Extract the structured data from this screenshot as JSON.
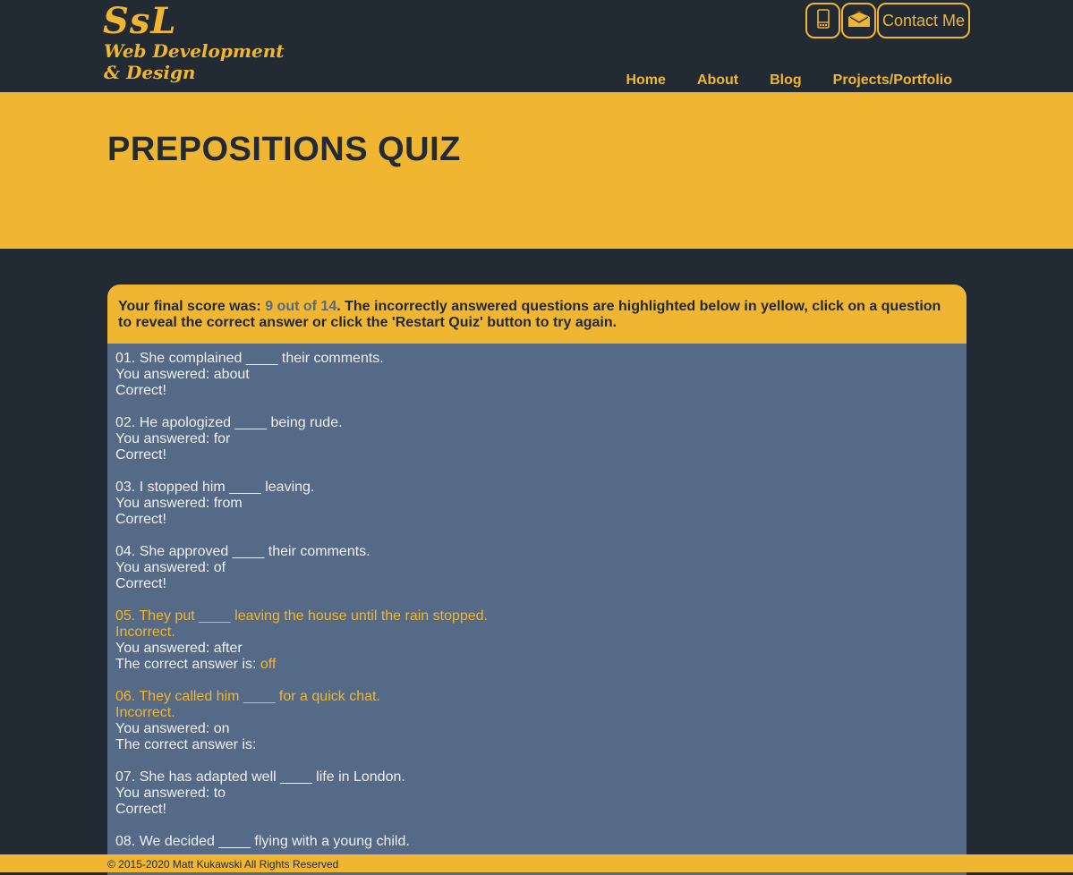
{
  "brand": {
    "mark": "SsL",
    "line1": "Web Development",
    "line2": "& Design"
  },
  "contact": {
    "phone_icon": "mobile-phone-icon",
    "email_icon": "envelope-icon",
    "label": "Contact Me"
  },
  "nav": {
    "items": [
      "Home",
      "About",
      "Blog",
      "Projects/Portfolio"
    ]
  },
  "hero": {
    "title": "PREPOSITIONS QUIZ"
  },
  "score": {
    "prefix": "Your final score was: ",
    "value": "9 out of 14",
    "suffix": ". The incorrectly answered questions are highlighted below in yellow, click on a question to reveal the correct answer or click the 'Restart Quiz' button to try again."
  },
  "questions": [
    {
      "text": "01. She complained ____ their comments.",
      "answered": "You answered: about",
      "status": "Correct!"
    },
    {
      "text": "02. He apologized ____ being rude.",
      "answered": "You answered: for",
      "status": "Correct!"
    },
    {
      "text": "03. I stopped him ____ leaving.",
      "answered": "You answered: from",
      "status": "Correct!"
    },
    {
      "text": "04. She approved ____ their comments.",
      "answered": "You answered: of",
      "status": "Correct!"
    },
    {
      "text": "05. They put ____ leaving the house until the rain stopped.",
      "status": "Incorrect.",
      "answered": "You answered: after",
      "correct_label": "The correct answer is: ",
      "correct_value": "off"
    },
    {
      "text": "06. They called him ____ for a quick chat.",
      "status": "Incorrect.",
      "answered": "You answered: on",
      "correct_label": "The correct answer is: ",
      "correct_value": ""
    },
    {
      "text": "07. She has adapted well ____ life in London.",
      "answered": "You answered: to",
      "status": "Correct!"
    },
    {
      "text": "08. We decided ____ flying with a young child."
    }
  ],
  "footer": {
    "text": "© 2015-2020 Matt Kukawski All Rights Reserved"
  },
  "colors": {
    "accent": "#f0b531",
    "dark": "#222b34",
    "panel": "#546a86"
  }
}
